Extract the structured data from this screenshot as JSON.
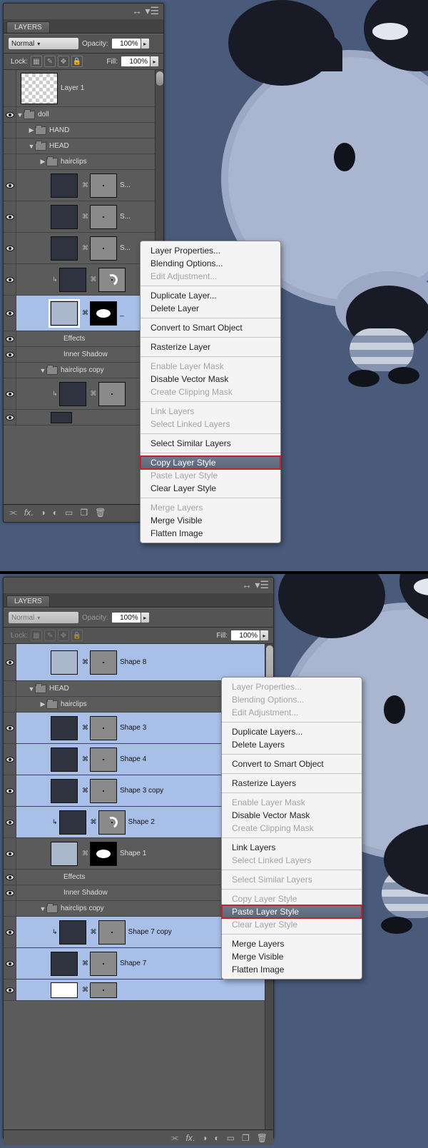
{
  "panel_title": "LAYERS",
  "blend_mode": "Normal",
  "opacity_label": "Opacity:",
  "opacity_value": "100%",
  "lock_label": "Lock:",
  "fill_label": "Fill:",
  "fill_value": "100%",
  "top": {
    "layers": {
      "layer1": "Layer 1",
      "doll": "doll",
      "hand": "HAND",
      "head": "HEAD",
      "hairclips": "hairclips",
      "s1": "S...",
      "s2": "S...",
      "s3": "S...",
      "dash": "_",
      "effects": "Effects",
      "inner_shadow": "Inner Shadow",
      "hairclips_copy": "hairclips copy"
    },
    "menu": {
      "layer_properties": "Layer Properties...",
      "blending_options": "Blending Options...",
      "edit_adjustment": "Edit Adjustment...",
      "duplicate_layer": "Duplicate Layer...",
      "delete_layer": "Delete Layer",
      "convert_smart": "Convert to Smart Object",
      "rasterize_layer": "Rasterize Layer",
      "enable_layer_mask": "Enable Layer Mask",
      "disable_vector_mask": "Disable Vector Mask",
      "create_clip_mask": "Create Clipping Mask",
      "link_layers": "Link Layers",
      "select_linked": "Select Linked Layers",
      "select_similar": "Select Similar Layers",
      "copy_layer_style": "Copy Layer Style",
      "paste_layer_style": "Paste Layer Style",
      "clear_layer_style": "Clear Layer Style",
      "merge_layers": "Merge Layers",
      "merge_visible": "Merge Visible",
      "flatten_image": "Flatten Image"
    }
  },
  "bottom": {
    "layers": {
      "shape8": "Shape 8",
      "head": "HEAD",
      "hairclips": "hairclips",
      "shape3": "Shape 3",
      "shape4": "Shape 4",
      "shape3copy": "Shape 3 copy",
      "shape2": "Shape 2",
      "shape1": "Shape 1",
      "effects": "Effects",
      "inner_shadow": "Inner Shadow",
      "hairclips_copy": "hairclips copy",
      "shape7copy": "Shape 7 copy",
      "shape7": "Shape 7"
    },
    "menu": {
      "layer_properties": "Layer Properties...",
      "blending_options": "Blending Options...",
      "edit_adjustment": "Edit Adjustment...",
      "duplicate_layers": "Duplicate Layers...",
      "delete_layers": "Delete Layers",
      "convert_smart": "Convert to Smart Object",
      "rasterize_layers": "Rasterize Layers",
      "enable_layer_mask": "Enable Layer Mask",
      "disable_vector_mask": "Disable Vector Mask",
      "create_clip_mask": "Create Clipping Mask",
      "link_layers": "Link Layers",
      "select_linked": "Select Linked Layers",
      "select_similar": "Select Similar Layers",
      "copy_layer_style": "Copy Layer Style",
      "paste_layer_style": "Paste Layer Style",
      "clear_layer_style": "Clear Layer Style",
      "merge_layers": "Merge Layers",
      "merge_visible": "Merge Visible",
      "flatten_image": "Flatten Image"
    }
  }
}
